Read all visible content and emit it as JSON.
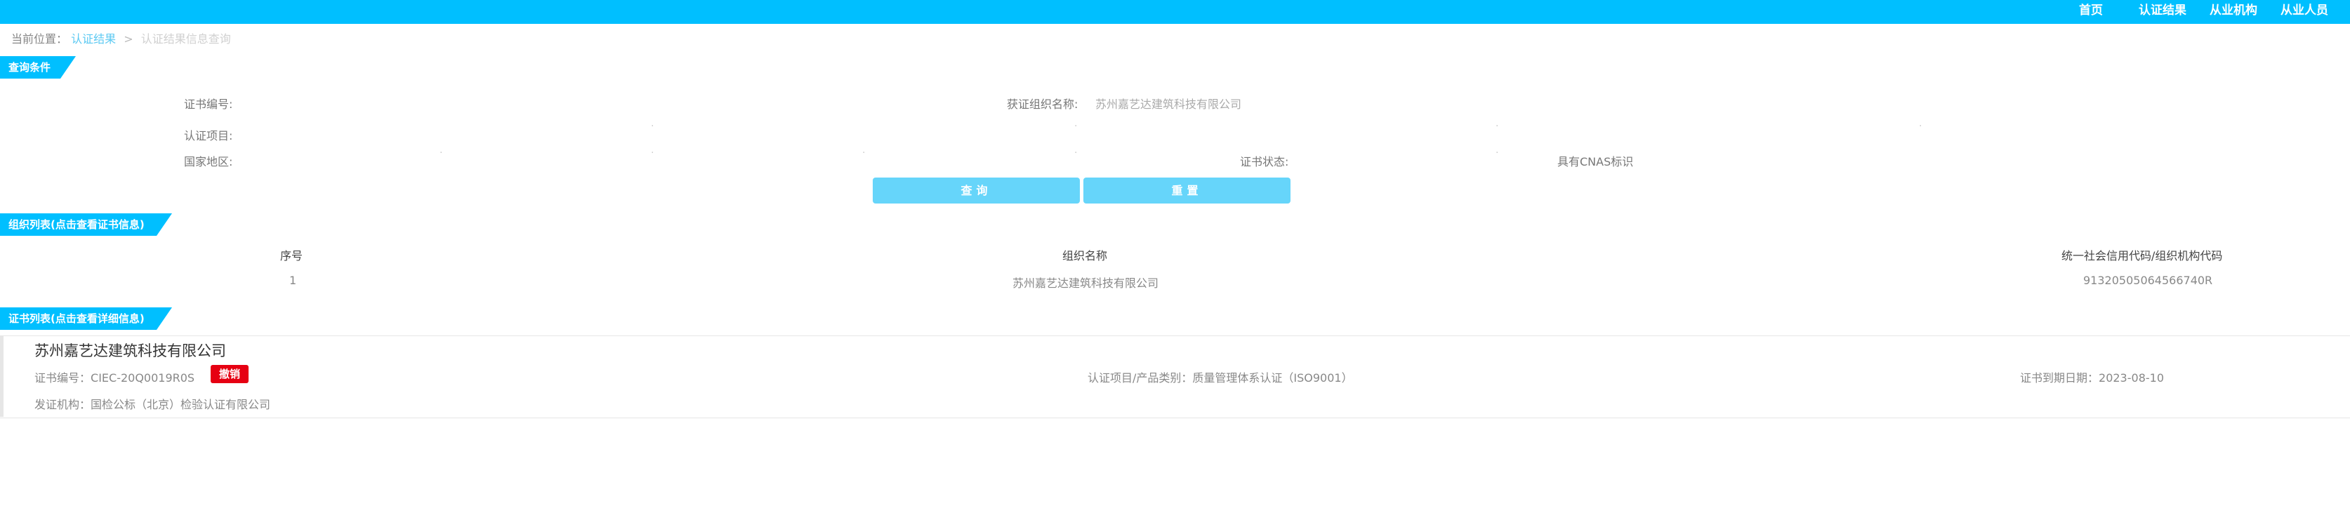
{
  "nav": {
    "items": [
      {
        "label": "首页"
      },
      {
        "label": "认证结果"
      },
      {
        "label": "从业机构"
      },
      {
        "label": "从业人员"
      }
    ]
  },
  "breadcrumb": {
    "prefix": "当前位置",
    "sep": ">",
    "link": "认证结果",
    "current": "认证结果信息查询"
  },
  "query": {
    "section_title": "查询条件",
    "fields": {
      "cert_no_label": "证书编号:",
      "org_name_label": "获证组织名称:",
      "org_name_value": "苏州嘉艺达建筑科技有限公司",
      "cert_item_label": "认证项目:",
      "region_label": "国家地区:",
      "status_label": "证书状态:",
      "cnas_label": "具有CNAS标识"
    },
    "search_button": "查询",
    "reset_button": "重置"
  },
  "org_list": {
    "section_title": "组织列表(点击查看证书信息)",
    "columns": [
      "序号",
      "组织名称",
      "统一社会信用代码/组织机构代码"
    ],
    "rows": [
      {
        "index": "1",
        "name": "苏州嘉艺达建筑科技有限公司",
        "code": "91320505064566740R"
      }
    ]
  },
  "cert_list": {
    "section_title": "证书列表(点击查看详细信息)",
    "items": [
      {
        "org_name": "苏州嘉艺达建筑科技有限公司",
        "cert_no_label": "证书编号：",
        "cert_no": "CIEC-20Q0019R0S",
        "status_badge": "撤销",
        "project_label": "认证项目/产品类别：",
        "project": "质量管理体系认证（ISO9001）",
        "expiry_label": "证书到期日期：",
        "expiry": "2023-08-10",
        "issuer_label": "发证机构：",
        "issuer": "国检公标（北京）检验认证有限公司"
      }
    ]
  },
  "colors": {
    "accent": "#00bfff",
    "button": "#66d5fa",
    "badge": "#e60012"
  }
}
